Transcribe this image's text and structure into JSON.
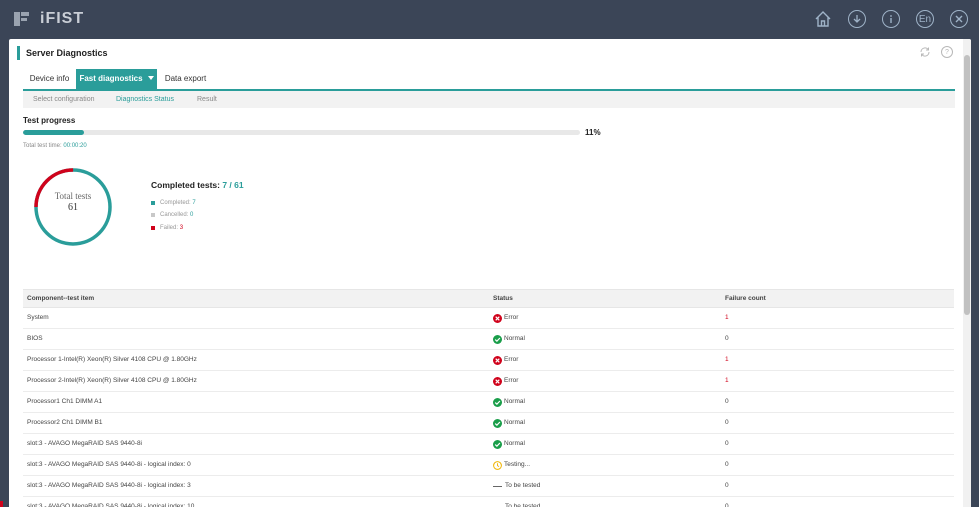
{
  "app": {
    "name": "iFIST"
  },
  "topbar": {
    "lang_label": "En"
  },
  "modal": {
    "title": "Server Diagnostics"
  },
  "tabs": [
    {
      "label": "Device info"
    },
    {
      "label": "Fast diagnostics"
    },
    {
      "label": "Data export"
    }
  ],
  "subtabs": [
    {
      "label": "Select configuration"
    },
    {
      "label": "Diagnostics Status"
    },
    {
      "label": "Result"
    }
  ],
  "progress": {
    "label": "Test progress",
    "fraction": 0.11,
    "percent_text": "11%",
    "time_label": "Total test time:",
    "time_value": "00:00:20"
  },
  "summary": {
    "donut_label": "Total tests",
    "total": "61",
    "completed_title": "Completed tests:",
    "completed_value": "7 / 61",
    "legend": [
      {
        "label": "Completed:",
        "value": "7",
        "color": "#2a9d9a"
      },
      {
        "label": "Cancelled:",
        "value": "0",
        "color": "#c8c8c8"
      },
      {
        "label": "Failed:",
        "value": "3",
        "color": "#d0021b"
      }
    ]
  },
  "table": {
    "headers": [
      "Component--test item",
      "Status",
      "Failure count"
    ],
    "rows": [
      {
        "component": "System",
        "status": "Error",
        "icon": "error-icon",
        "count": "1"
      },
      {
        "component": "BIOS",
        "status": "Normal",
        "icon": "check-icon",
        "count": "0"
      },
      {
        "component": "Processor 1-Intel(R) Xeon(R) Silver 4108 CPU @ 1.80GHz",
        "status": "Error",
        "icon": "error-icon",
        "count": "1"
      },
      {
        "component": "Processor 2-Intel(R) Xeon(R) Silver 4108 CPU @ 1.80GHz",
        "status": "Error",
        "icon": "error-icon",
        "count": "1"
      },
      {
        "component": "Processor1 Ch1 DIMM A1",
        "status": "Normal",
        "icon": "check-icon",
        "count": "0"
      },
      {
        "component": "Processor2 Ch1 DIMM B1",
        "status": "Normal",
        "icon": "check-icon",
        "count": "0"
      },
      {
        "component": "slot:3 - AVAGO MegaRAID SAS 9440-8i",
        "status": "Normal",
        "icon": "check-icon",
        "count": "0"
      },
      {
        "component": "slot:3 - AVAGO MegaRAID SAS 9440-8i - logical index: 0",
        "status": "Testing...",
        "icon": "clock-icon",
        "count": "0"
      },
      {
        "component": "slot:3 - AVAGO MegaRAID SAS 9440-8i - logical index: 3",
        "status": "To be tested",
        "icon": "dash-icon",
        "count": "0"
      },
      {
        "component": "slot:3 - AVAGO MegaRAID SAS 9440-8i - logical index: 10",
        "status": "To be tested",
        "icon": "dash-icon",
        "count": "0"
      }
    ]
  },
  "colors": {
    "accent": "#2a9d9a",
    "error": "#d0021b",
    "normal": "#1a9e4a",
    "testing": "#f0b400",
    "topbar": "#3b4557"
  }
}
